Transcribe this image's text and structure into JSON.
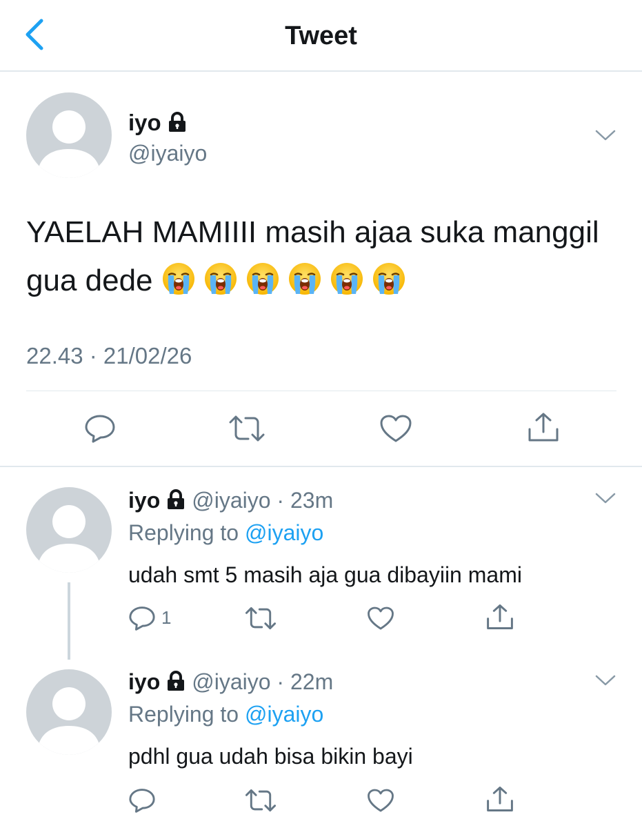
{
  "header": {
    "title": "Tweet",
    "back_icon": "chevron-left-icon",
    "accent_color": "#1da1f2"
  },
  "main_tweet": {
    "name": "iyo",
    "handle": "@iyaiyo",
    "text": "YAELAH MAMIIII masih ajaa suka manggil gua dede",
    "emojis": [
      "loudly-crying-face",
      "loudly-crying-face",
      "loudly-crying-face",
      "loudly-crying-face",
      "loudly-crying-face",
      "loudly-crying-face"
    ],
    "timestamp": "22.43 · 21/02/26",
    "actions": [
      "reply-icon",
      "retweet-icon",
      "like-icon",
      "share-icon"
    ]
  },
  "replies": [
    {
      "name": "iyo",
      "handle": "@iyaiyo",
      "time": "23m",
      "replying_prefix": "Replying to",
      "replying_to": "@iyaiyo",
      "text": "udah smt 5 masih aja gua dibayiin mami",
      "reply_count": "1"
    },
    {
      "name": "iyo",
      "handle": "@iyaiyo",
      "time": "22m",
      "replying_prefix": "Replying to",
      "replying_to": "@iyaiyo",
      "text": "pdhl gua udah bisa bikin bayi",
      "reply_count": ""
    }
  ],
  "colors": {
    "text": "#14171a",
    "secondary": "#657786",
    "link": "#1da1f2",
    "divider": "#e1e8ed",
    "avatar_bg": "#cdd3d8"
  }
}
